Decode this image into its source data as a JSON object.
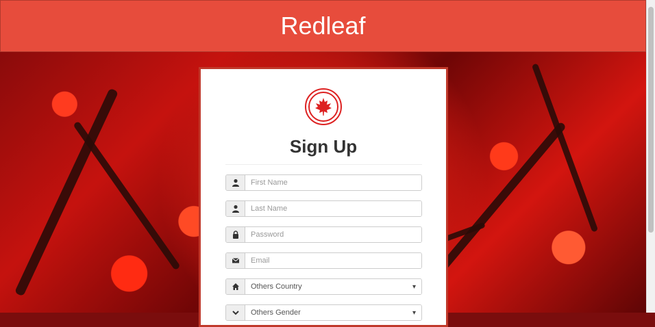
{
  "header": {
    "brand": "Redleaf"
  },
  "signup": {
    "title": "Sign Up",
    "fields": [
      {
        "icon": "user-icon",
        "placeholder": "First Name"
      },
      {
        "icon": "user-icon",
        "placeholder": "Last Name"
      },
      {
        "icon": "lock-icon",
        "placeholder": "Password"
      },
      {
        "icon": "envelope-icon",
        "placeholder": "Email"
      }
    ],
    "selects": [
      {
        "icon": "home-icon",
        "value": "Others Country"
      },
      {
        "icon": "chevron-down-icon",
        "value": "Others Gender"
      }
    ]
  },
  "colors": {
    "header_bg": "#e74c3c",
    "card_border": "#c0392b",
    "accent": "#dd2222"
  }
}
